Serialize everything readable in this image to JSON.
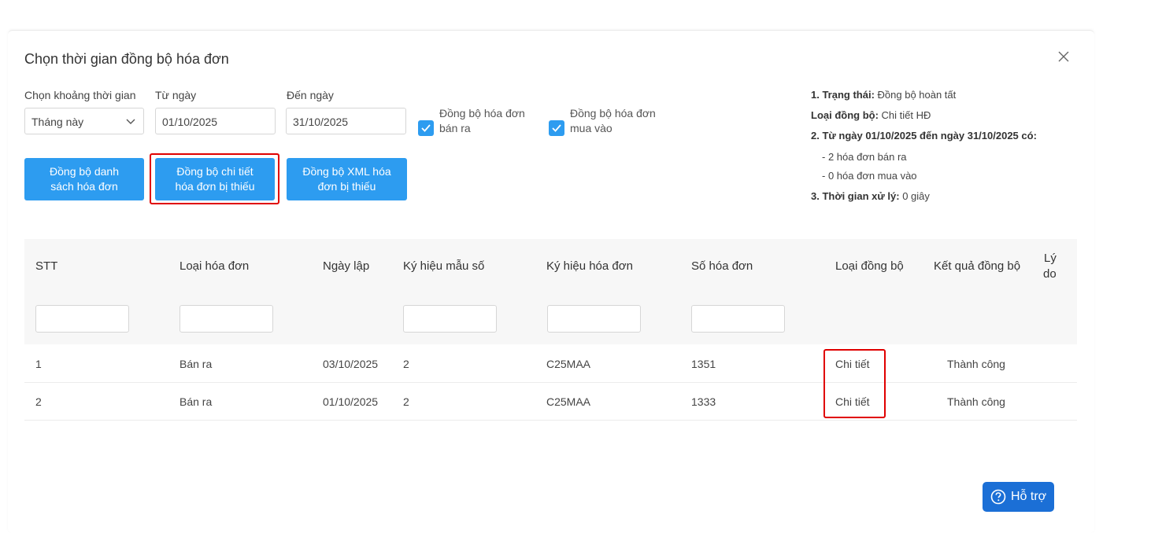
{
  "dialog": {
    "title": "Chọn thời gian đồng bộ hóa đơn"
  },
  "filters": {
    "period_label": "Chọn khoảng thời gian",
    "period_value": "Tháng này",
    "from_label": "Từ ngày",
    "from_value": "01/10/2025",
    "to_label": "Đến ngày",
    "to_value": "31/10/2025",
    "sync_out_label_1": "Đồng bộ hóa đơn",
    "sync_out_label_2": "bán ra",
    "sync_out_checked": true,
    "sync_in_label_1": "Đồng bộ hóa đơn",
    "sync_in_label_2": "mua vào",
    "sync_in_checked": true
  },
  "buttons": {
    "sync_list_1": "Đồng bộ danh",
    "sync_list_2": "sách hóa đơn",
    "sync_detail_1": "Đồng bộ chi tiết",
    "sync_detail_2": "hóa đơn bị thiếu",
    "sync_xml_1": "Đồng bộ XML hóa",
    "sync_xml_2": "đơn bị thiếu"
  },
  "status": {
    "l1_key": "1. Trạng thái:",
    "l1_val": " Đồng bộ hoàn tất",
    "l2_key": "Loại đồng bộ:",
    "l2_val": " Chi tiết HĐ",
    "l3_key": "2. Từ ngày 01/10/2025 đến ngày 31/10/2025 có:",
    "l4": "- 2 hóa đơn bán ra",
    "l5": "- 0 hóa đơn mua vào",
    "l6_key": "3. Thời gian xử lý:",
    "l6_val": " 0 giây"
  },
  "table": {
    "headers": [
      "STT",
      "Loại hóa đơn",
      "Ngày lập",
      "Ký hiệu mẫu số",
      "Ký hiệu hóa đơn",
      "Số hóa đơn",
      "Loại đồng bộ",
      "Kết quả đồng bộ",
      "Lý",
      "do"
    ],
    "rows": [
      [
        "1",
        "Bán ra",
        "03/10/2025",
        "2",
        "C25MAA",
        "1351",
        "Chi tiết",
        "Thành công"
      ],
      [
        "2",
        "Bán ra",
        "01/10/2025",
        "2",
        "C25MAA",
        "1333",
        "Chi tiết",
        "Thành công"
      ]
    ]
  },
  "help": {
    "label": "Hỗ trợ"
  },
  "colors": {
    "primary": "#2d9cf0",
    "highlight": "#e00000",
    "help_button": "#1b6fd6"
  }
}
